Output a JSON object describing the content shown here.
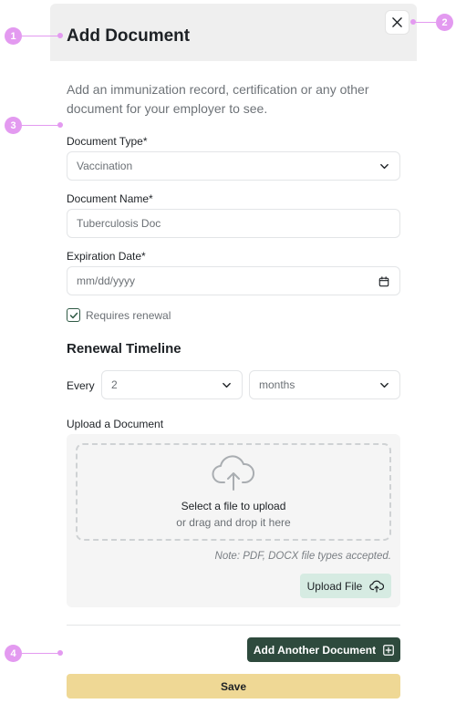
{
  "modal": {
    "title": "Add Document",
    "description": "Add an immunization record, certification or any other document for your employer to see."
  },
  "form": {
    "document_type_label": "Document Type*",
    "document_type_value": "Vaccination",
    "document_name_label": "Document Name*",
    "document_name_placeholder": "Tuberculosis Doc",
    "expiration_label": "Expiration Date*",
    "expiration_placeholder": "mm/dd/yyyy",
    "requires_renewal_label": "Requires renewal",
    "requires_renewal_checked": true
  },
  "renewal": {
    "title": "Renewal Timeline",
    "every_label": "Every",
    "interval_value": "2",
    "unit_value": "months"
  },
  "upload": {
    "label": "Upload a Document",
    "drop_main": "Select a file to upload",
    "drop_sub": "or drag and drop it here",
    "note": "Note: PDF, DOCX file types accepted.",
    "button_label": "Upload File"
  },
  "actions": {
    "add_another_label": "Add Another Document",
    "save_label": "Save"
  },
  "annotations": {
    "m1": "1",
    "m2": "2",
    "m3": "3",
    "m4": "4"
  },
  "colors": {
    "primary_dark": "#2e4a3d",
    "upload_button": "#d6ebe2",
    "save_button": "#efd895",
    "annotation": "#e39af0"
  }
}
